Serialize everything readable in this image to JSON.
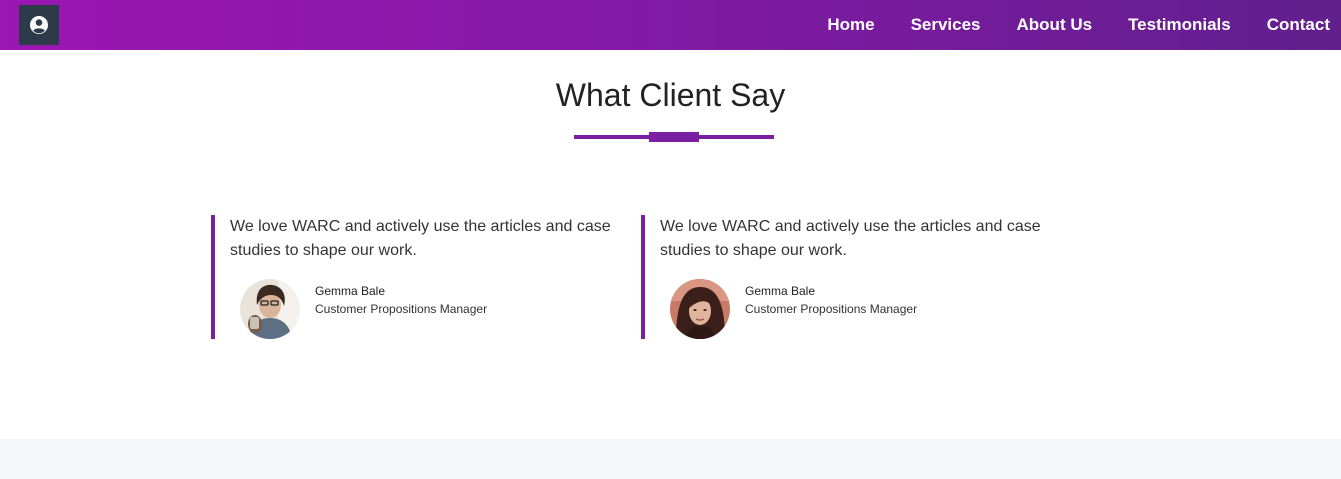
{
  "navbar": {
    "user_icon": "user-circle-icon",
    "gradient": [
      "#9b16b3",
      "#611f8d"
    ],
    "links": [
      {
        "label": "Home"
      },
      {
        "label": "Services"
      },
      {
        "label": "About Us"
      },
      {
        "label": "Testimonials"
      },
      {
        "label": "Contact"
      }
    ]
  },
  "testimonials": {
    "title": "What Client Say",
    "accent_color": "#7b1fa2",
    "items": [
      {
        "quote": "We love WARC and actively use the articles and case studies to shape our work.",
        "name": "Gemma Bale",
        "role": "Customer Propositions Manager"
      },
      {
        "quote": "We love WARC and actively use the articles and case studies to shape our work.",
        "name": "Gemma Bale",
        "role": "Customer Propositions Manager"
      }
    ]
  }
}
